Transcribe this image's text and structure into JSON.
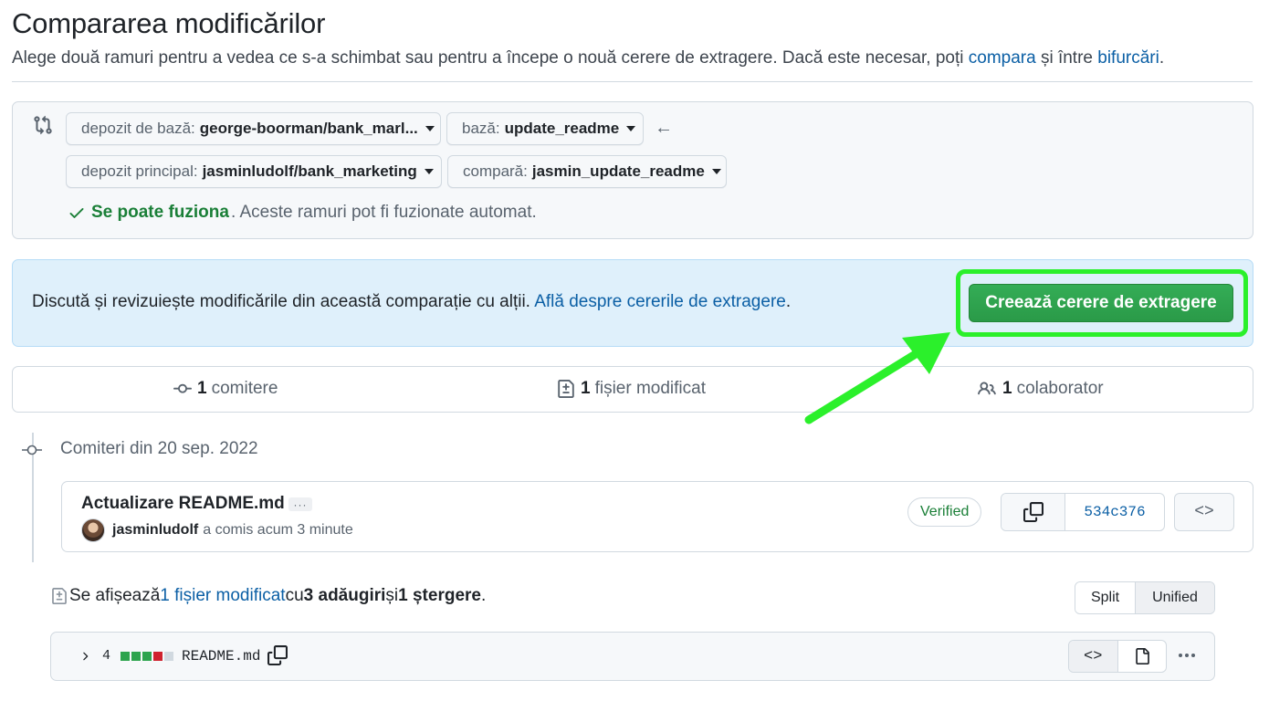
{
  "header": {
    "title": "Compararea modificărilor",
    "subtitle_prefix": "Alege două ramuri pentru a vedea ce s-a schimbat sau pentru a începe o nouă cerere de extragere. Dacă este necesar, poți ",
    "subtitle_link_compare": "compara",
    "subtitle_middle": " și între ",
    "subtitle_link_forks": "bifurcări",
    "subtitle_suffix": "."
  },
  "range": {
    "base_repo_label": "depozit de bază:",
    "base_repo_value": "george-boorman/bank_marl...",
    "base_label": "bază:",
    "base_value": "update_readme",
    "head_repo_label": "depozit principal:",
    "head_repo_value": "jasminludolf/bank_marketing",
    "compare_label": "compară:",
    "compare_value": "jasmin_update_readme",
    "merge_ok": "Se poate fuziona",
    "merge_text": ". Aceste ramuri pot fi fuzionate automat."
  },
  "info": {
    "text": "Discută și revizuiește modificările din această comparație cu alții. ",
    "link": "Află despre cererile de extragere",
    "suffix": ".",
    "create_button": "Creează cerere de extragere"
  },
  "stats": {
    "commits_count": "1",
    "commits_label": "comitere",
    "files_count": "1",
    "files_label": "fișier modificat",
    "contributors_count": "1",
    "contributors_label": "colaborator"
  },
  "commits": {
    "date_heading": "Comiteri din 20 sep. 2022",
    "title": "Actualizare README.md",
    "ellipsis": "···",
    "author": "jasminludolf",
    "meta": "a comis acum 3 minute",
    "verified": "Verified",
    "sha": "534c376",
    "code_symbol": "<>"
  },
  "summary": {
    "prefix": "Se afișează ",
    "files_link": "1 fișier modificat",
    "with": " cu ",
    "additions": "3 adăugiri",
    "and": " și ",
    "deletions": "1 ștergere",
    "suffix": "."
  },
  "view": {
    "split": "Split",
    "unified": "Unified"
  },
  "file": {
    "changes": "4",
    "diffstat": [
      "add",
      "add",
      "add",
      "del",
      "neutral"
    ],
    "name": "README.md",
    "code_symbol": "<>"
  },
  "colors": {
    "accent_link": "#0b5fa5",
    "success": "#1a7f37",
    "create_button": "#2da44e",
    "highlight": "#2bf02b",
    "info_bg": "#dff0fb",
    "diff_add": "#2da44e",
    "diff_del": "#cf222e",
    "diff_neutral": "#d1d9e0"
  },
  "icons": {
    "range": "git-compare-icon",
    "back": "arrow-left-icon",
    "check": "check-icon",
    "commit": "git-commit-icon",
    "file_diff": "file-diff-icon",
    "people": "people-icon",
    "copy": "copy-icon",
    "file": "file-icon",
    "chevron": "chevron-right-icon",
    "kebab": "kebab-horizontal-icon"
  }
}
